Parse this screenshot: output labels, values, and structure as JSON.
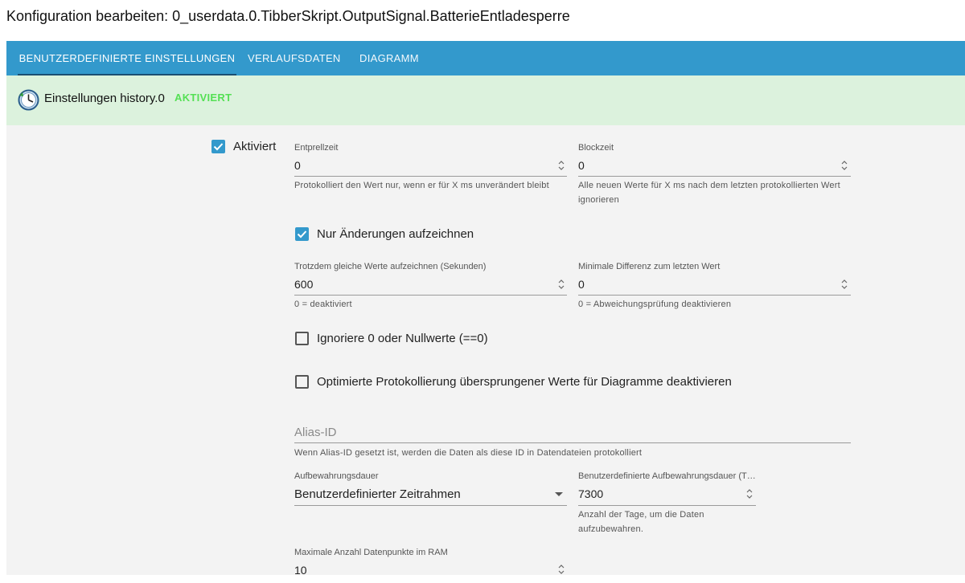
{
  "dialog": {
    "title": "Konfiguration bearbeiten: 0_userdata.0.TibberSkript.OutputSignal.BatterieEntladesperre"
  },
  "tabs": [
    {
      "label": "BENUTZERDEFINIERTE EINSTELLUNGEN",
      "active": true
    },
    {
      "label": "VERLAUFSDATEN",
      "active": false
    },
    {
      "label": "DIAGRAMM",
      "active": false
    }
  ],
  "status": {
    "icon": "history-clock-icon",
    "name": "Einstellungen history.0",
    "badge": "AKTIVIERT"
  },
  "settings": {
    "enabled": {
      "label": "Aktiviert",
      "checked": true
    },
    "debounce": {
      "label": "Entprellzeit",
      "value": "0",
      "help": "Protokolliert den Wert nur, wenn er für X ms unverändert bleibt"
    },
    "blocktime": {
      "label": "Blockzeit",
      "value": "0",
      "help": "Alle neuen Werte für X ms nach dem letzten protokollierten Wert ignorieren"
    },
    "changes_only": {
      "label": "Nur Änderungen aufzeichnen",
      "checked": true
    },
    "change_interval": {
      "label": "Trotzdem gleiche Werte aufzeichnen (Sekunden)",
      "value": "600",
      "help": "0 = deaktiviert"
    },
    "min_diff": {
      "label": "Minimale Differenz zum letzten Wert",
      "value": "0",
      "help": "0 = Abweichungsprüfung deaktivieren"
    },
    "ignore_zero": {
      "label": "Ignoriere 0 oder Nullwerte (==0)",
      "checked": false
    },
    "disable_skipped": {
      "label": "Optimierte Protokollierung übersprungener Werte für Diagramme deaktivieren",
      "checked": false
    },
    "alias": {
      "placeholder": "Alias-ID",
      "value": "",
      "help": "Wenn Alias-ID gesetzt ist, werden die Daten als diese ID in Datendateien protokolliert"
    },
    "retention": {
      "label": "Aufbewahrungsdauer",
      "value": "Benutzerdefinierter Zeitrahmen"
    },
    "custom_retention": {
      "label": "Benutzerdefinierte Aufbewahrungsdauer (T…",
      "value": "7300",
      "help": "Anzahl der Tage, um die Daten aufzubewahren."
    },
    "max_ram": {
      "label": "Maximale Anzahl Datenpunkte im RAM",
      "value": "10"
    }
  },
  "colors": {
    "tabbar": "#3399cc",
    "status_bg": "#dcf2dd",
    "badge": "#55e055",
    "checkbox": "#3399cc",
    "content_bg": "#f3f3f3"
  }
}
